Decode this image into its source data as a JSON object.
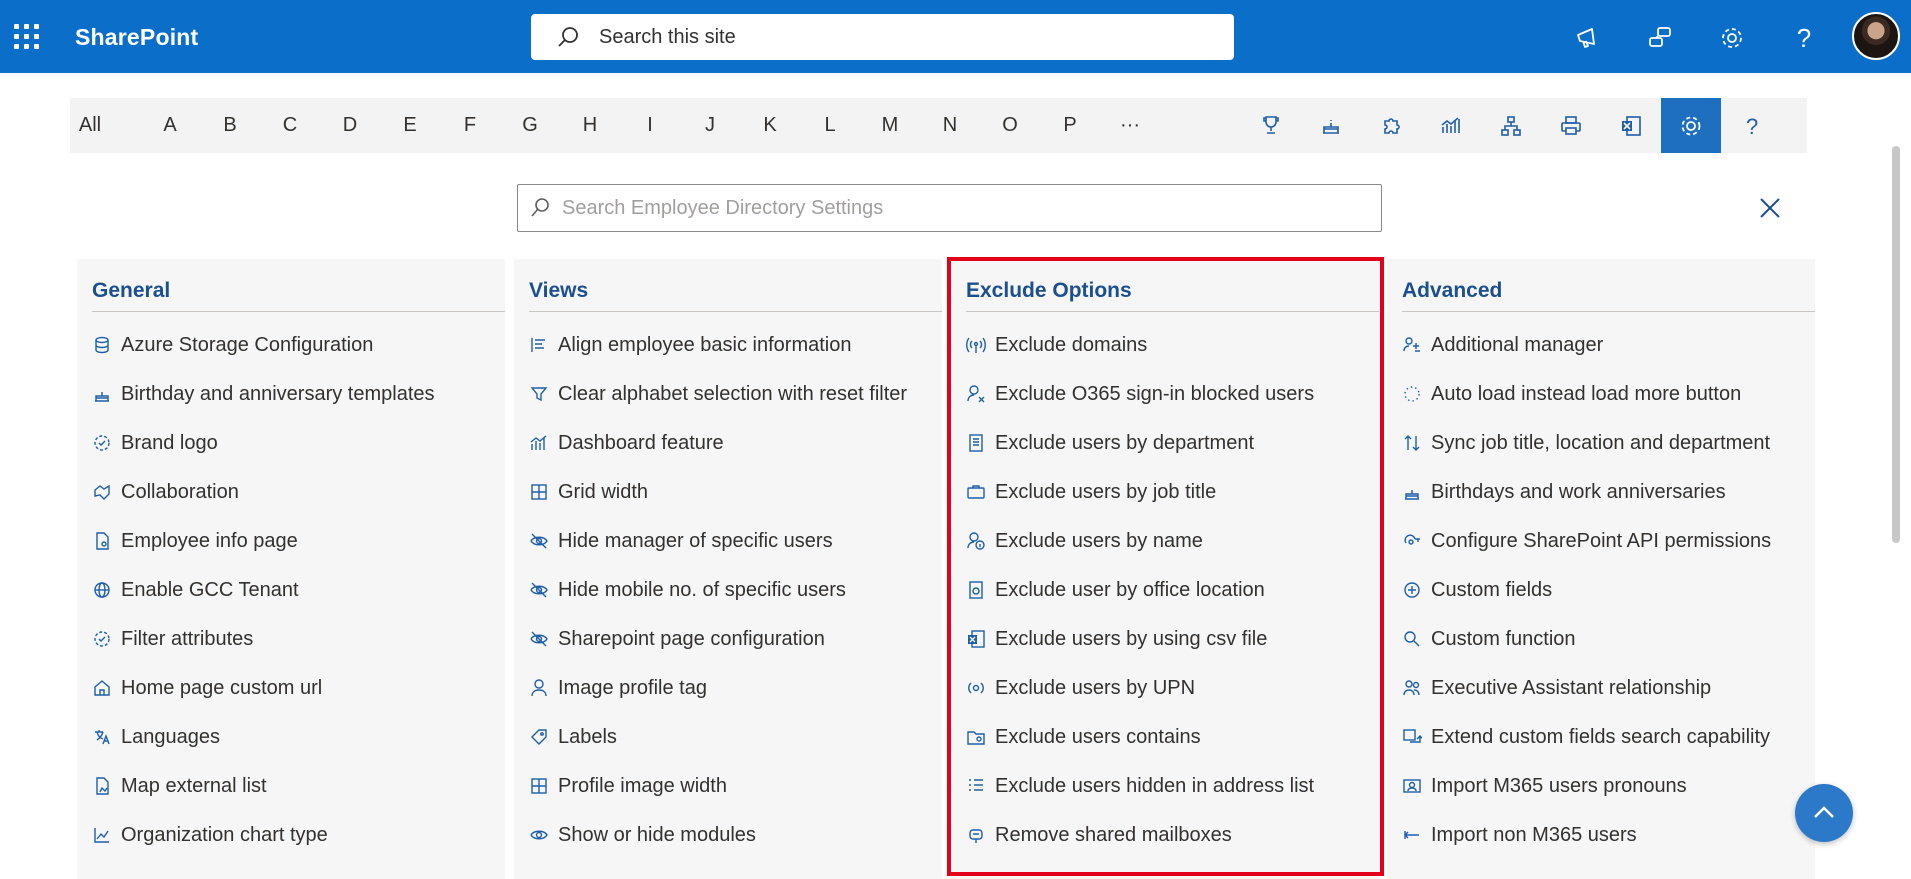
{
  "suitebar": {
    "brand": "SharePoint",
    "search_placeholder": "Search this site",
    "icons": [
      "megaphone-icon",
      "chat-icon",
      "settings-gear-icon",
      "help-icon",
      "avatar"
    ]
  },
  "alphabet": {
    "letters": [
      "All",
      "A",
      "B",
      "C",
      "D",
      "E",
      "F",
      "G",
      "H",
      "I",
      "J",
      "K",
      "L",
      "M",
      "N",
      "O",
      "P",
      "···"
    ],
    "tools": [
      "trophy-icon",
      "cake-icon",
      "puzzle-icon",
      "chart-icon",
      "org-chart-icon",
      "print-icon",
      "excel-icon",
      "settings-icon",
      "help-icon"
    ],
    "active_tool": "settings-icon"
  },
  "settings_search": {
    "placeholder": "Search Employee Directory Settings"
  },
  "colors": {
    "brand": "#0b6fc9",
    "heading": "#1c4f8f",
    "highlight": "#e3001b"
  },
  "columns": [
    {
      "title": "General",
      "items": [
        {
          "label": "Azure Storage Configuration",
          "icon": "database-icon"
        },
        {
          "label": "Birthday and anniversary templates",
          "icon": "cake-icon"
        },
        {
          "label": "Brand logo",
          "icon": "badge-icon"
        },
        {
          "label": "Collaboration",
          "icon": "handshake-icon"
        },
        {
          "label": "Employee info page",
          "icon": "document-person-icon"
        },
        {
          "label": "Enable GCC Tenant",
          "icon": "globe-icon"
        },
        {
          "label": "Filter attributes",
          "icon": "badge-icon"
        },
        {
          "label": "Home page custom url",
          "icon": "home-icon"
        },
        {
          "label": "Languages",
          "icon": "translate-icon"
        },
        {
          "label": "Map external list",
          "icon": "map-document-icon"
        },
        {
          "label": "Organization chart type",
          "icon": "chart-area-icon"
        }
      ]
    },
    {
      "title": "Views",
      "items": [
        {
          "label": "Align employee basic information",
          "icon": "align-left-icon"
        },
        {
          "label": "Clear alphabet selection with reset filter",
          "icon": "filter-icon"
        },
        {
          "label": "Dashboard feature",
          "icon": "bar-chart-icon"
        },
        {
          "label": "Grid width",
          "icon": "grid-icon"
        },
        {
          "label": "Hide manager of specific users",
          "icon": "eye-off-icon"
        },
        {
          "label": "Hide mobile no. of specific users",
          "icon": "eye-off-icon"
        },
        {
          "label": "Sharepoint page configuration",
          "icon": "eye-off-icon"
        },
        {
          "label": "Image profile tag",
          "icon": "person-icon"
        },
        {
          "label": "Labels",
          "icon": "tag-icon"
        },
        {
          "label": "Profile image width",
          "icon": "grid-icon"
        },
        {
          "label": "Show or hide modules",
          "icon": "eye-icon"
        }
      ]
    },
    {
      "title": "Exclude Options",
      "items": [
        {
          "label": "Exclude domains",
          "icon": "broadcast-icon"
        },
        {
          "label": "Exclude O365 sign-in blocked users",
          "icon": "person-x-icon"
        },
        {
          "label": "Exclude users by department",
          "icon": "document-list-icon"
        },
        {
          "label": "Exclude users by job title",
          "icon": "briefcase-icon"
        },
        {
          "label": "Exclude users by name",
          "icon": "person-info-icon"
        },
        {
          "label": "Exclude user by office location",
          "icon": "building-icon"
        },
        {
          "label": "Exclude users by using csv file",
          "icon": "excel-icon"
        },
        {
          "label": "Exclude users by UPN",
          "icon": "person-broadcast-icon"
        },
        {
          "label": "Exclude users contains",
          "icon": "folder-person-icon"
        },
        {
          "label": "Exclude users hidden in address list",
          "icon": "list-icon"
        },
        {
          "label": "Remove shared mailboxes",
          "icon": "mailbox-icon"
        }
      ]
    },
    {
      "title": "Advanced",
      "items": [
        {
          "label": "Additional manager",
          "icon": "people-add-icon"
        },
        {
          "label": "Auto load instead load more button",
          "icon": "loading-icon"
        },
        {
          "label": "Sync job title, location and department",
          "icon": "sync-arrows-icon"
        },
        {
          "label": "Birthdays and work anniversaries",
          "icon": "cake-icon"
        },
        {
          "label": "Configure SharePoint API permissions",
          "icon": "key-cloud-icon"
        },
        {
          "label": "Custom fields",
          "icon": "add-circle-icon"
        },
        {
          "label": "Custom function",
          "icon": "search-function-icon"
        },
        {
          "label": "Executive Assistant relationship",
          "icon": "people-icon"
        },
        {
          "label": "Extend custom fields search capability",
          "icon": "extend-icon"
        },
        {
          "label": "Import M365 users pronouns",
          "icon": "contact-card-icon"
        },
        {
          "label": "Import non M365 users",
          "icon": "arrow-left-icon"
        }
      ]
    }
  ]
}
